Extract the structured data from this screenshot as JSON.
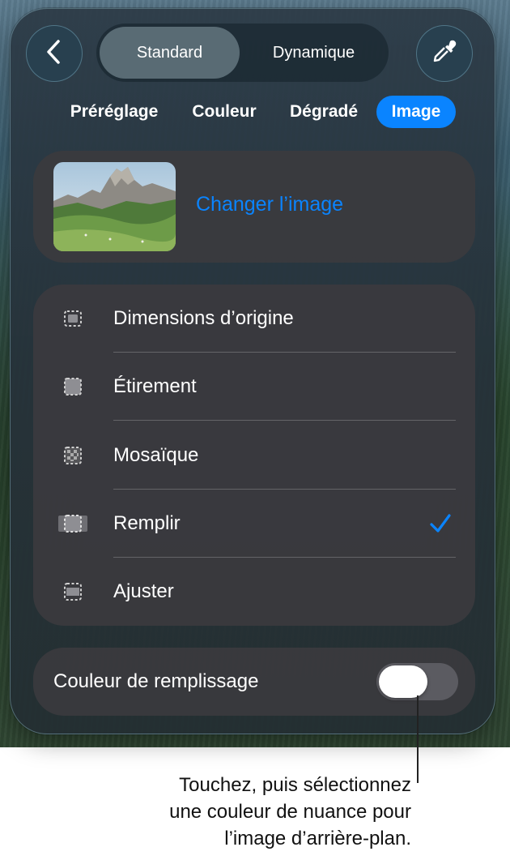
{
  "header": {
    "back_icon": "chevron-left-icon",
    "eyedropper_icon": "eyedropper-icon",
    "segments": [
      "Standard",
      "Dynamique"
    ],
    "selected_segment": "Standard"
  },
  "tabs": {
    "items": [
      "Préréglage",
      "Couleur",
      "Dégradé",
      "Image"
    ],
    "selected": "Image"
  },
  "image_card": {
    "change_label": "Changer l’image"
  },
  "options": {
    "items": [
      {
        "label": "Dimensions d’origine",
        "icon": "original-size-icon"
      },
      {
        "label": "Étirement",
        "icon": "stretch-icon"
      },
      {
        "label": "Mosaïque",
        "icon": "tile-icon"
      },
      {
        "label": "Remplir",
        "icon": "fill-icon",
        "selected": true
      },
      {
        "label": "Ajuster",
        "icon": "fit-icon"
      }
    ],
    "check_icon": "checkmark-icon"
  },
  "fill_color": {
    "label": "Couleur de remplissage",
    "toggle_on": false
  },
  "callout": {
    "line1": "Touchez, puis sélectionnez",
    "line2": "une couleur de nuance pour",
    "line3": "l’image d’arrière-plan."
  },
  "colors": {
    "accent": "#0a84ff",
    "card": "#3a3a3e",
    "text": "#ffffff"
  }
}
